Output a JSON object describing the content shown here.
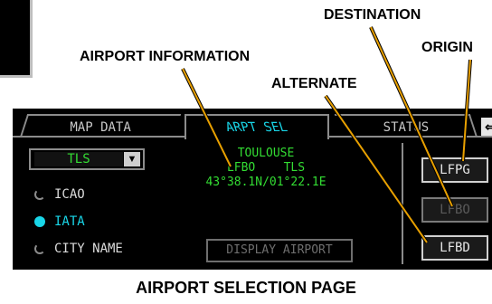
{
  "callouts": {
    "destination": "DESTINATION",
    "origin": "ORIGIN",
    "airport_information": "AIRPORT INFORMATION",
    "alternate": "ALTERNATE"
  },
  "tabs": {
    "map_data": "MAP DATA",
    "arpt_sel": "ARPT SEL",
    "status": "STATUS",
    "more": "⇐"
  },
  "airport_select": {
    "value": "TLS",
    "arrow": "▼"
  },
  "radio_options": [
    {
      "label": "ICAO",
      "selected": false
    },
    {
      "label": "IATA",
      "selected": true
    },
    {
      "label": "CITY NAME",
      "selected": false
    }
  ],
  "airport_info": {
    "city": "TOULOUSE",
    "icao": "LFBO",
    "iata": "TLS",
    "icao_iata_line": "LFBO    TLS",
    "coordinates": "43°38.1N/01°22.1E"
  },
  "buttons": {
    "display_airport": "DISPLAY AIRPORT",
    "origin": "LFPG",
    "destination": "LFBO",
    "alternate": "LFBD"
  },
  "caption": "AIRPORT SELECTION PAGE",
  "colors": {
    "screen_bg": "#000000",
    "selected_cyan": "#19d6e8",
    "data_green": "#33dd33",
    "leader_orange": "#e8a000"
  }
}
